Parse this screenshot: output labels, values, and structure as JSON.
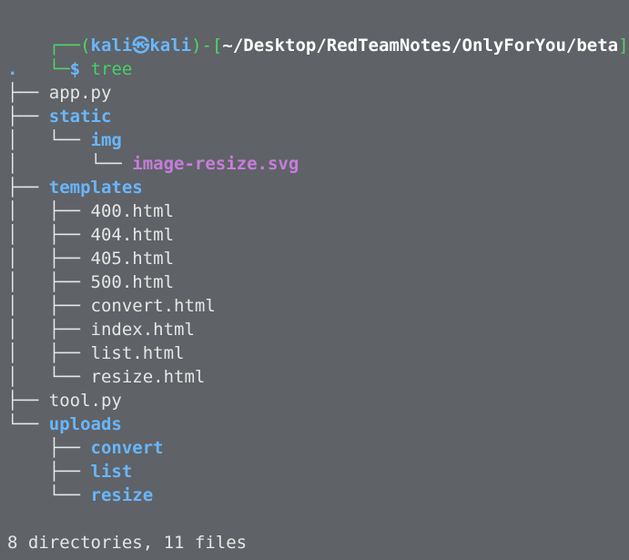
{
  "prompt": {
    "prefix": "┌──(",
    "user": "kali",
    "at": "㉿",
    "host": "kali",
    "mid": ")-[",
    "path": "~/Desktop/RedTeamNotes/OnlyForYou/beta",
    "suffix": "]",
    "second_prefix": "└─",
    "dollar": "$",
    "command": "tree"
  },
  "tree": {
    "root": ".",
    "lines": [
      {
        "prefix": "├── ",
        "name": "app.py",
        "kind": "file"
      },
      {
        "prefix": "├── ",
        "name": "static",
        "kind": "dir"
      },
      {
        "prefix": "│   └── ",
        "name": "img",
        "kind": "dir"
      },
      {
        "prefix": "│       └── ",
        "name": "image-resize.svg",
        "kind": "media"
      },
      {
        "prefix": "├── ",
        "name": "templates",
        "kind": "dir"
      },
      {
        "prefix": "│   ├── ",
        "name": "400.html",
        "kind": "file"
      },
      {
        "prefix": "│   ├── ",
        "name": "404.html",
        "kind": "file"
      },
      {
        "prefix": "│   ├── ",
        "name": "405.html",
        "kind": "file"
      },
      {
        "prefix": "│   ├── ",
        "name": "500.html",
        "kind": "file"
      },
      {
        "prefix": "│   ├── ",
        "name": "convert.html",
        "kind": "file"
      },
      {
        "prefix": "│   ├── ",
        "name": "index.html",
        "kind": "file"
      },
      {
        "prefix": "│   ├── ",
        "name": "list.html",
        "kind": "file"
      },
      {
        "prefix": "│   └── ",
        "name": "resize.html",
        "kind": "file"
      },
      {
        "prefix": "├── ",
        "name": "tool.py",
        "kind": "file"
      },
      {
        "prefix": "└── ",
        "name": "uploads",
        "kind": "dir"
      },
      {
        "prefix": "    ├── ",
        "name": "convert",
        "kind": "dir"
      },
      {
        "prefix": "    ├── ",
        "name": "list",
        "kind": "dir"
      },
      {
        "prefix": "    └── ",
        "name": "resize",
        "kind": "dir"
      }
    ]
  },
  "summary": "8 directories, 11 files",
  "colors": {
    "background": "#5f6266",
    "prompt_green": "#4fd66a",
    "directory_blue": "#69b6ff",
    "media_purple": "#c77ddc",
    "text": "#e6e6e6"
  }
}
